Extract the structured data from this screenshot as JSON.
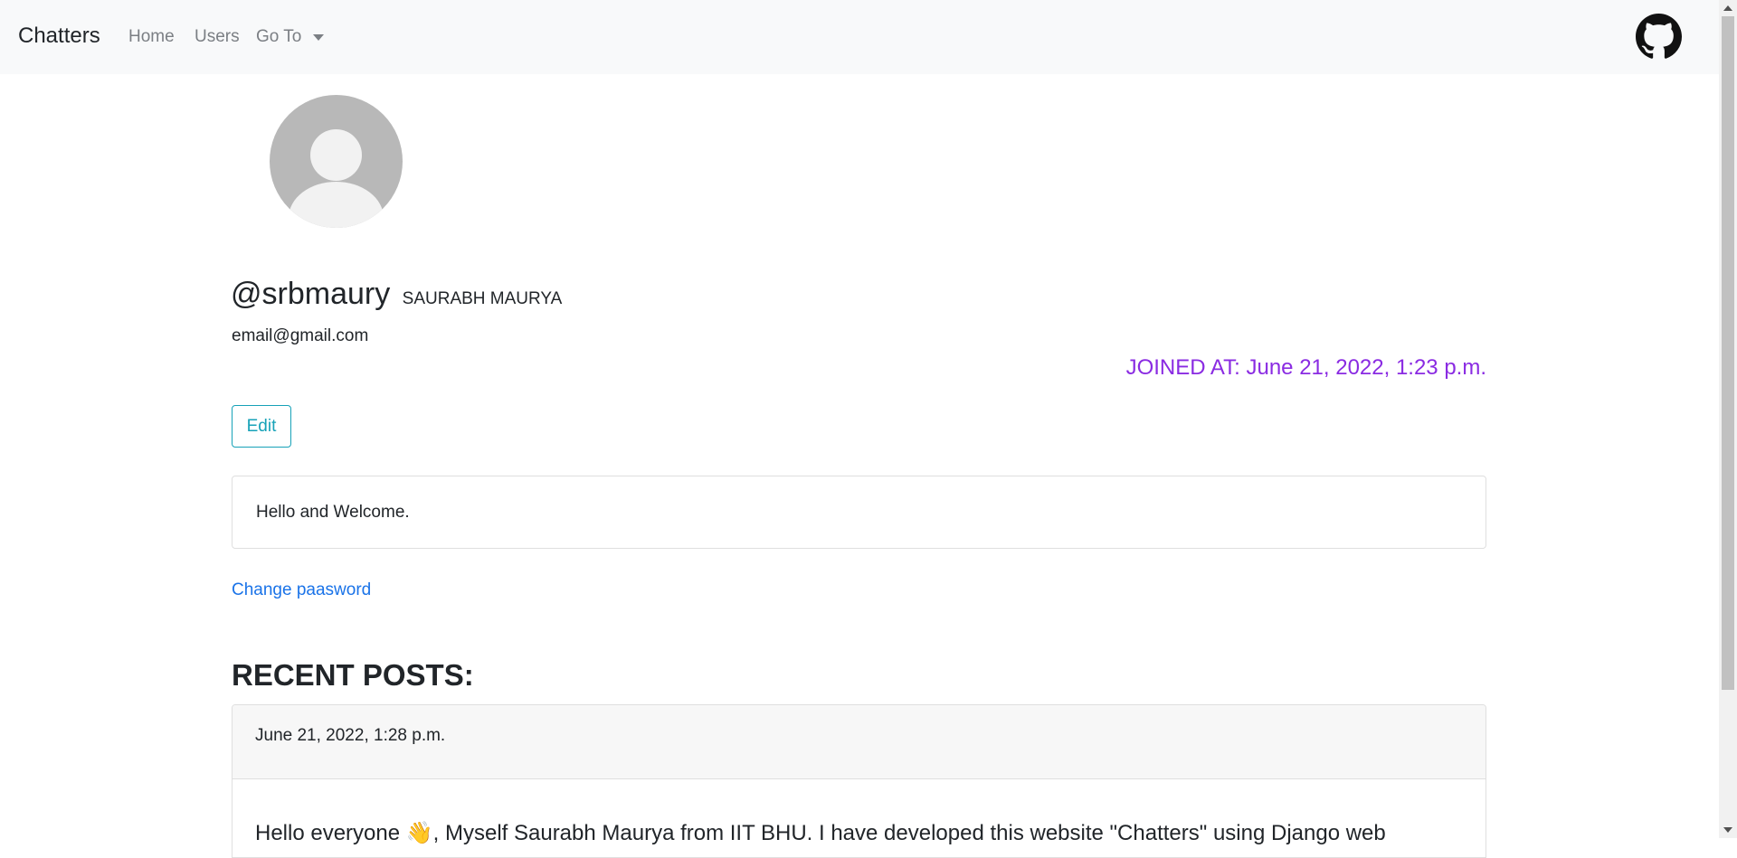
{
  "navbar": {
    "brand": "Chatters",
    "links": {
      "home": "Home",
      "users": "Users",
      "goto": "Go To"
    }
  },
  "profile": {
    "username": "@srbmaury",
    "full_name": "Saurabh Maurya",
    "email": "email@gmail.com",
    "joined": "JOINED AT: June 21, 2022, 1:23 p.m.",
    "edit_label": "Edit",
    "bio": "Hello and Welcome.",
    "change_password_label": "Change paasword"
  },
  "recent_posts": {
    "title": "RECENT POSTS:",
    "posts": [
      {
        "date": "June 21, 2022, 1:28 p.m.",
        "body": "Hello everyone 👋, Myself Saurabh Maurya from IIT BHU. I have developed this website \"Chatters\" using Django web"
      }
    ]
  },
  "colors": {
    "joined_text": "#8a2be2",
    "edit_border": "#17a2b8",
    "link": "#1a73e8",
    "navbar_bg": "#f8f9fa"
  },
  "icons": {
    "github": "github-icon",
    "avatar": "default-user-avatar"
  }
}
